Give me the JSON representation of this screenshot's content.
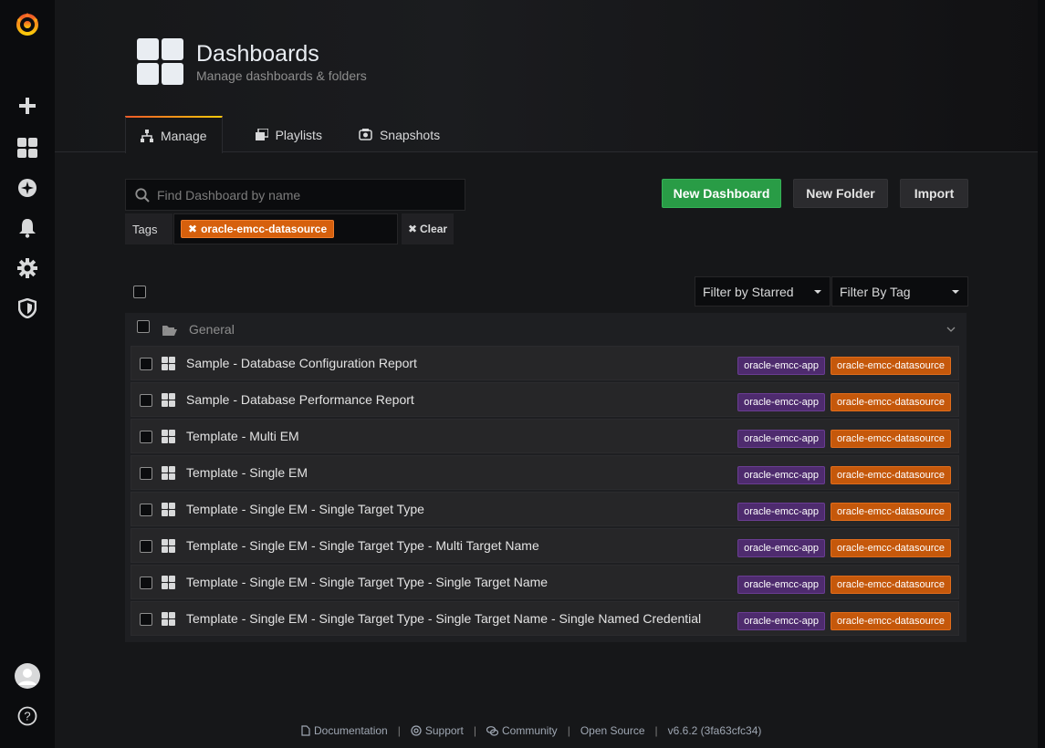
{
  "header": {
    "title": "Dashboards",
    "subtitle": "Manage dashboards & folders"
  },
  "tabs": [
    {
      "label": "Manage",
      "icon": "sitemap-icon"
    },
    {
      "label": "Playlists",
      "icon": "playlist-icon"
    },
    {
      "label": "Snapshots",
      "icon": "camera-icon"
    }
  ],
  "search": {
    "placeholder": "Find Dashboard by name",
    "value": ""
  },
  "tags_filter": {
    "label": "Tags",
    "selected_tag": "oracle-emcc-datasource",
    "clear_label": "Clear"
  },
  "actions": {
    "new_dashboard": "New Dashboard",
    "new_folder": "New Folder",
    "import": "Import"
  },
  "filters": {
    "starred": "Filter by Starred",
    "by_tag": "Filter By Tag"
  },
  "folder": {
    "name": "General"
  },
  "dashboards": [
    {
      "title": "Sample - Database Configuration Report",
      "tags": [
        "oracle-emcc-app",
        "oracle-emcc-datasource"
      ]
    },
    {
      "title": "Sample - Database Performance Report",
      "tags": [
        "oracle-emcc-app",
        "oracle-emcc-datasource"
      ]
    },
    {
      "title": "Template - Multi EM",
      "tags": [
        "oracle-emcc-app",
        "oracle-emcc-datasource"
      ]
    },
    {
      "title": "Template - Single EM",
      "tags": [
        "oracle-emcc-app",
        "oracle-emcc-datasource"
      ]
    },
    {
      "title": "Template - Single EM - Single Target Type",
      "tags": [
        "oracle-emcc-app",
        "oracle-emcc-datasource"
      ]
    },
    {
      "title": "Template - Single EM - Single Target Type - Multi Target Name",
      "tags": [
        "oracle-emcc-app",
        "oracle-emcc-datasource"
      ]
    },
    {
      "title": "Template - Single EM - Single Target Type - Single Target Name",
      "tags": [
        "oracle-emcc-app",
        "oracle-emcc-datasource"
      ]
    },
    {
      "title": "Template - Single EM - Single Target Type - Single Target Name - Single Named Credential",
      "tags": [
        "oracle-emcc-app",
        "oracle-emcc-datasource"
      ]
    }
  ],
  "footer": {
    "documentation": "Documentation",
    "support": "Support",
    "community": "Community",
    "open_source": "Open Source",
    "version": "v6.6.2 (3fa63cfc34)"
  },
  "colors": {
    "accent": "#f58f3f",
    "primary_button": "#299c46",
    "tag_purple": "#4e2b6e",
    "tag_orange": "#c5580b"
  }
}
